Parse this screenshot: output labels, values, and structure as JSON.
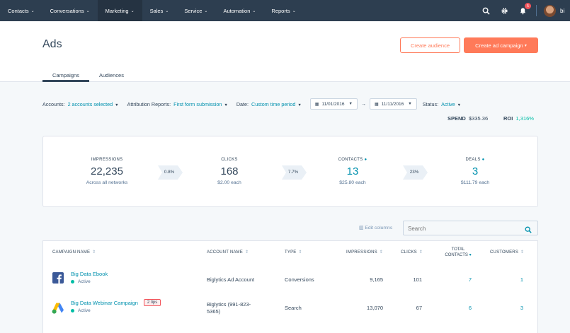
{
  "nav": {
    "items": [
      {
        "label": "Contacts"
      },
      {
        "label": "Conversations"
      },
      {
        "label": "Marketing"
      },
      {
        "label": "Sales"
      },
      {
        "label": "Service"
      },
      {
        "label": "Automation"
      },
      {
        "label": "Reports"
      }
    ],
    "active_item": "Marketing",
    "icons": [
      "search-icon",
      "gear-icon",
      "bell-icon"
    ],
    "notification_count": "5",
    "account_label": "bi"
  },
  "header": {
    "title": "Ads",
    "create_audience": "Create audience",
    "create_campaign": "Create ad campaign",
    "create_campaign_caret": "▾",
    "tabs": [
      {
        "label": "Campaigns",
        "active": true
      },
      {
        "label": "Audiences",
        "active": false
      }
    ]
  },
  "filters": {
    "accounts_label": "Accounts:",
    "accounts_value": "2 accounts selected",
    "attribution_label": "Attribution Reports:",
    "attribution_value": "First form submission",
    "date_label": "Date:",
    "date_value": "Custom time period",
    "start_date": "11/01/2016",
    "end_date": "11/11/2016",
    "date_arrow": "→",
    "status_label": "Status:",
    "status_value": "Active"
  },
  "summary": {
    "spend_label": "SPEND",
    "spend_value": "$335.36",
    "roi_label": "ROI",
    "roi_value": "1,316%"
  },
  "metrics": [
    {
      "label": "IMPRESSIONS",
      "value": "22,235",
      "sub": "Across all networks",
      "info": false
    },
    {
      "label": "CLICKS",
      "value": "168",
      "sub": "$2.00 each",
      "info": false
    },
    {
      "label": "CONTACTS",
      "value": "13",
      "sub": "$25.80 each",
      "info": true
    },
    {
      "label": "DEALS",
      "value": "3",
      "sub": "$111.79 each",
      "info": true
    }
  ],
  "conversions": [
    "0.8%",
    "7.7%",
    "23%"
  ],
  "table_tools": {
    "edit_columns": "Edit columns",
    "search_placeholder": "Search"
  },
  "table": {
    "headers": {
      "campaign": "CAMPAIGN NAME",
      "account": "ACCOUNT NAME",
      "type": "TYPE",
      "impressions": "IMPRESSIONS",
      "clicks": "CLICKS",
      "total_contacts_1": "TOTAL",
      "total_contacts_2": "CONTACTS",
      "customers": "CUSTOMERS"
    },
    "sort_glyph": "⇕",
    "rows": [
      {
        "network_icon": "facebook-icon",
        "name": "Big Data Ebook",
        "status": "Active",
        "tips": "",
        "account": "Biglytics Ad Account",
        "account_2": "",
        "type": "Conversions",
        "impressions": "9,165",
        "clicks": "101",
        "contacts": "7",
        "customers": "1"
      },
      {
        "network_icon": "google-ads-icon",
        "name": "Big Data Webinar Campaign",
        "status": "Active",
        "tips": "2 tips",
        "account": "Biglytics (991-823-",
        "account_2": "5365)",
        "type": "Search",
        "impressions": "13,070",
        "clicks": "67",
        "contacts": "6",
        "customers": "3"
      }
    ]
  },
  "colors": {
    "nav_bg": "#2d3e50",
    "accent": "#ff7a59",
    "link": "#0091ae",
    "active_dot": "#00bda5",
    "roi": "#00bda5"
  }
}
